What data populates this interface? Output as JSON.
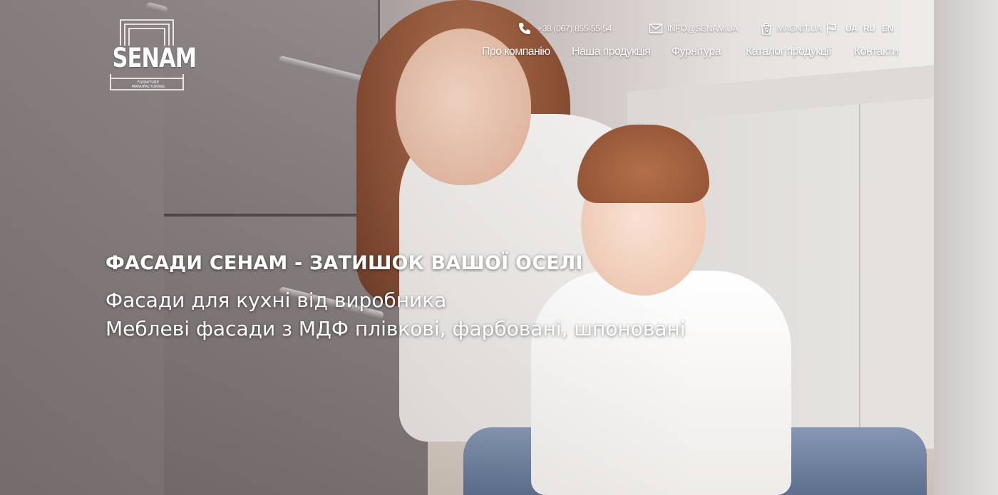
{
  "brand": {
    "logo_text": "SENAM",
    "logo_tagline": "FURNITURE MANUFACTURING"
  },
  "topbar": {
    "phone_icon": "phone-icon",
    "phone": "+38 (067) 855-55-54",
    "email_icon": "envelope-icon",
    "email": "INFO@SENAM.UA",
    "shop_icon": "shopping-bag-icon",
    "shop": "MAGNIT.UA",
    "lang_icon": "flag-icon",
    "languages": [
      "UA",
      "RU",
      "EN"
    ]
  },
  "nav": {
    "items": [
      "Про компанію",
      "Наша продукція",
      "Фурнітура",
      "Каталог продукції",
      "Контакти"
    ]
  },
  "hero": {
    "title": "ФАСАДИ СЕНАМ - ЗАТИШОК ВАШОЇ ОСЕЛІ",
    "line1": "Фасади для кухні від виробника",
    "line2": "Меблеві фасади з МДФ плівкові, фарбовані, шпоновані"
  },
  "colors": {
    "text": "#ffffff"
  }
}
